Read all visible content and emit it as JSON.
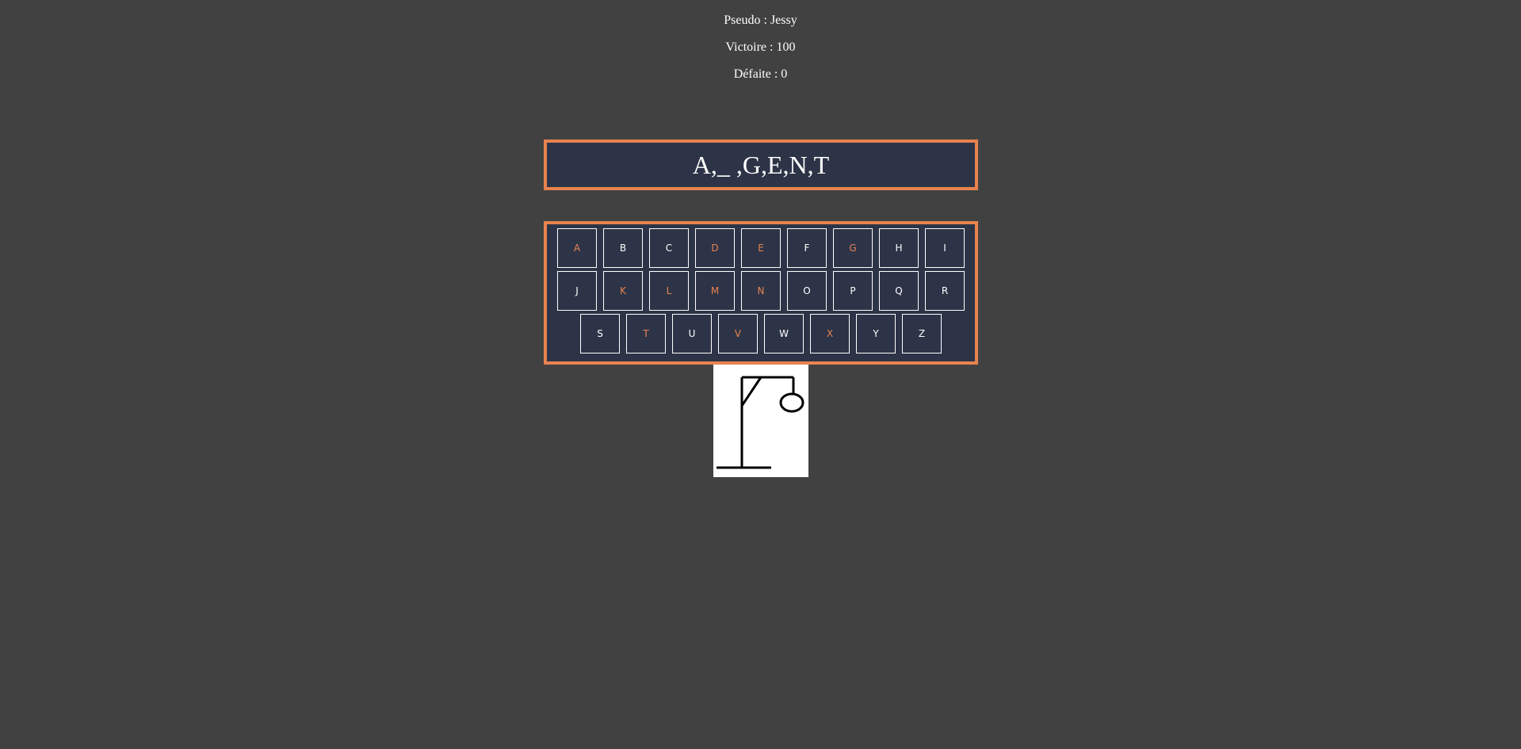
{
  "stats": {
    "pseudo": "Pseudo : Jessy",
    "wins": "Victoire : 100",
    "losses": "Défaite : 0"
  },
  "word": {
    "display": "A,_ ,G,E,N,T"
  },
  "keyboard": {
    "row1": [
      {
        "letter": "A",
        "used": true
      },
      {
        "letter": "B",
        "used": false
      },
      {
        "letter": "C",
        "used": false
      },
      {
        "letter": "D",
        "used": true
      },
      {
        "letter": "E",
        "used": true
      },
      {
        "letter": "F",
        "used": false
      },
      {
        "letter": "G",
        "used": true
      },
      {
        "letter": "H",
        "used": false
      },
      {
        "letter": "I",
        "used": false
      }
    ],
    "row2": [
      {
        "letter": "J",
        "used": false
      },
      {
        "letter": "K",
        "used": true
      },
      {
        "letter": "L",
        "used": true
      },
      {
        "letter": "M",
        "used": true
      },
      {
        "letter": "N",
        "used": true
      },
      {
        "letter": "O",
        "used": false
      },
      {
        "letter": "P",
        "used": false
      },
      {
        "letter": "Q",
        "used": false
      },
      {
        "letter": "R",
        "used": false
      }
    ],
    "row3": [
      {
        "letter": "S",
        "used": false
      },
      {
        "letter": "T",
        "used": true
      },
      {
        "letter": "U",
        "used": false
      },
      {
        "letter": "V",
        "used": true
      },
      {
        "letter": "W",
        "used": false
      },
      {
        "letter": "X",
        "used": true
      },
      {
        "letter": "Y",
        "used": false
      },
      {
        "letter": "Z",
        "used": false
      }
    ]
  },
  "colors": {
    "background": "#414141",
    "panel": "#2e3447",
    "accent": "#e8834f",
    "text": "#ffffff"
  },
  "hangman": {
    "stage_icon": "gallows-with-head-icon",
    "errors_shown": 2
  }
}
